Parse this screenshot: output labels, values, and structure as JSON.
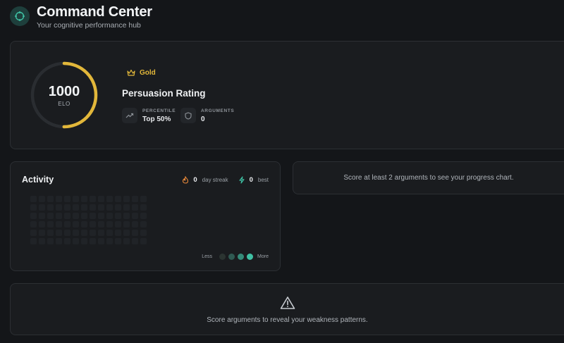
{
  "header": {
    "title": "Command Center",
    "subtitle": "Your cognitive performance hub"
  },
  "rating": {
    "elo_value": "1000",
    "elo_unit": "ELO",
    "gauge_fill": 0.5,
    "tier": "Gold",
    "title": "Persuasion Rating",
    "stats": [
      {
        "label": "PERCENTILE",
        "value": "Top 50%",
        "icon": "trend-up-icon"
      },
      {
        "label": "ARGUMENTS",
        "value": "0",
        "icon": "shield-icon"
      }
    ]
  },
  "activity": {
    "title": "Activity",
    "streak_value": "0",
    "streak_label": "day streak",
    "best_value": "0",
    "best_label": "best",
    "legend_less": "Less",
    "legend_more": "More",
    "legend_colors": [
      "#2b3431",
      "#2f5a52",
      "#358b79",
      "#3fc1a4"
    ]
  },
  "progress": {
    "message": "Score at least 2 arguments to see your progress chart."
  },
  "weakness": {
    "message": "Score arguments to reveal your weakness patterns."
  },
  "colors": {
    "accent_gold": "#e2b73a",
    "accent_teal": "#3fc1a4",
    "streak_orange": "#e8893a"
  }
}
